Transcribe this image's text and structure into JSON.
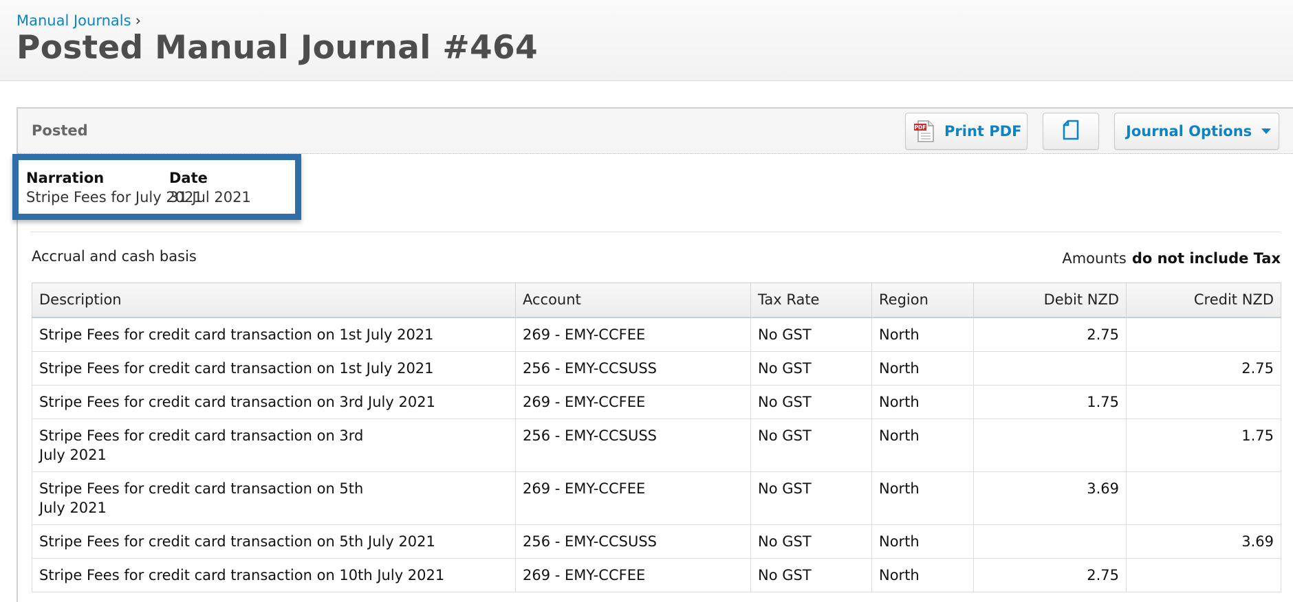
{
  "header": {
    "breadcrumb_link": "Manual Journals",
    "breadcrumb_sep": "›",
    "title": "Posted Manual Journal #464"
  },
  "panel": {
    "status": "Posted",
    "print_pdf_label": "Print PDF",
    "journal_options_label": "Journal Options"
  },
  "narration": {
    "narration_label": "Narration",
    "narration_value": "Stripe Fees for July 2021",
    "date_label": "Date",
    "date_value": "31 Jul 2021"
  },
  "basis": "Accrual and cash basis",
  "amounts": {
    "prefix": "Amounts",
    "emphasis": "do not include Tax"
  },
  "table": {
    "headers": [
      "Description",
      "Account",
      "Tax Rate",
      "Region",
      "Debit NZD",
      "Credit NZD"
    ],
    "rows": [
      {
        "desc_line1": "Stripe Fees for credit card transaction on 1st July 2021",
        "desc_line2": "",
        "account": "269 - EMY-CCFEE",
        "tax": "No GST",
        "region": "North",
        "debit": "2.75",
        "credit": ""
      },
      {
        "desc_line1": "Stripe Fees for credit card transaction on 1st July 2021",
        "desc_line2": "",
        "account": "256 - EMY-CCSUSS",
        "tax": "No GST",
        "region": "North",
        "debit": "",
        "credit": "2.75"
      },
      {
        "desc_line1": "Stripe Fees for credit card transaction on 3rd July 2021",
        "desc_line2": "",
        "account": "269 - EMY-CCFEE",
        "tax": "No GST",
        "region": "North",
        "debit": "1.75",
        "credit": ""
      },
      {
        "desc_line1": "Stripe Fees for credit card transaction on 3rd",
        "desc_line2": "July 2021",
        "account": "256 - EMY-CCSUSS",
        "tax": "No GST",
        "region": "North",
        "debit": "",
        "credit": "1.75"
      },
      {
        "desc_line1": "Stripe Fees for credit card transaction on 5th",
        "desc_line2": "July 2021",
        "account": "269 - EMY-CCFEE",
        "tax": "No GST",
        "region": "North",
        "debit": "3.69",
        "credit": ""
      },
      {
        "desc_line1": "Stripe Fees for credit card transaction on 5th July 2021",
        "desc_line2": "",
        "account": "256 - EMY-CCSUSS",
        "tax": "No GST",
        "region": "North",
        "debit": "",
        "credit": "3.69"
      },
      {
        "desc_line1": "Stripe Fees for credit card transaction on 10th July 2021",
        "desc_line2": "",
        "account": "269 - EMY-CCFEE",
        "tax": "No GST",
        "region": "North",
        "debit": "2.75",
        "credit": ""
      }
    ]
  },
  "icons": {
    "pdf": "pdf-file-icon",
    "copy": "copy-document-icon",
    "caret": "caret-down-icon"
  },
  "colors": {
    "link": "#0c84c4",
    "highlight_border": "#2f6ea8",
    "pdf_red": "#d8232a"
  }
}
